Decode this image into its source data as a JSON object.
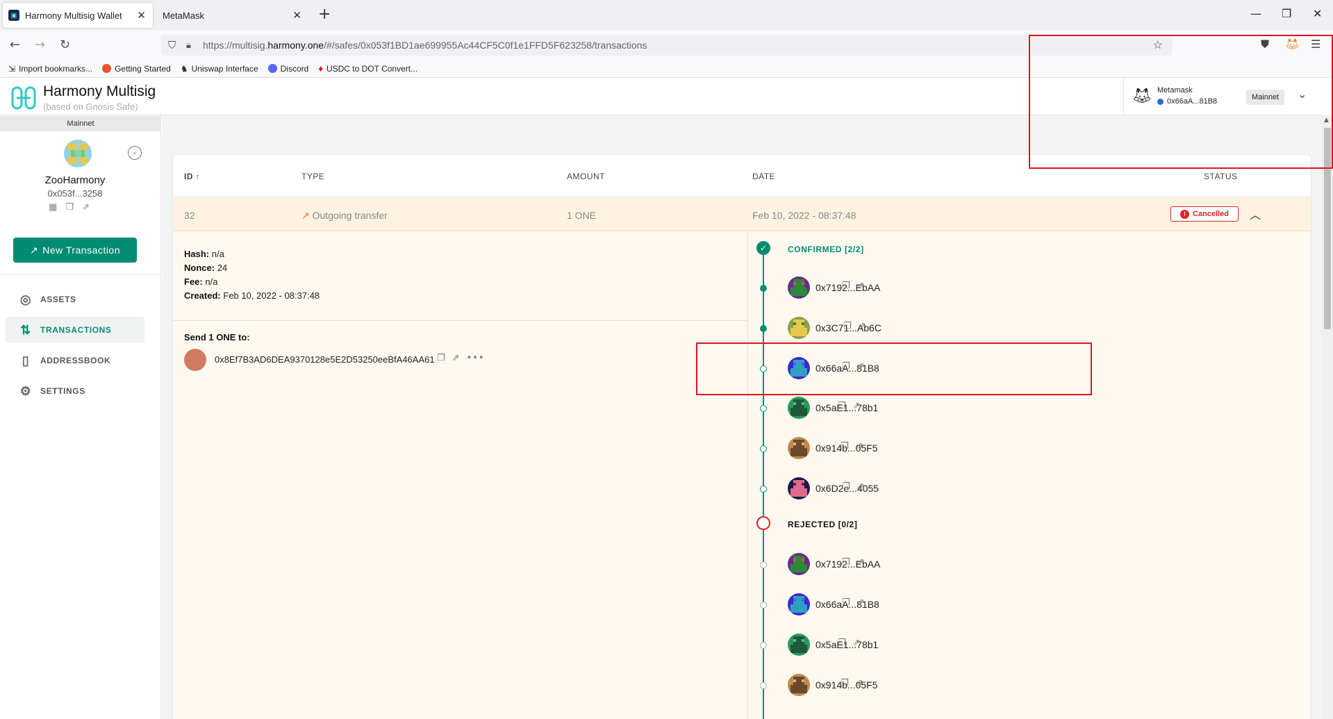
{
  "browser": {
    "tabs": [
      {
        "label": "Harmony Multisig Wallet",
        "active": true
      },
      {
        "label": "MetaMask",
        "active": false
      }
    ],
    "url_prefix": "https://multisig.",
    "url_host": "harmony.one",
    "url_path": "/#/safes/0x053f1BD1ae699955Ac44CF5C0f1e1FFD5F623258/transactions",
    "bookmarks": [
      {
        "label": "Import bookmarks...",
        "color": "#555555"
      },
      {
        "label": "Getting Started",
        "color": "#e8532a"
      },
      {
        "label": "Uniswap Interface",
        "color": "#ff007a"
      },
      {
        "label": "Discord",
        "color": "#5865f2"
      },
      {
        "label": "USDC to DOT Convert...",
        "color": "#e0141e"
      }
    ]
  },
  "header": {
    "title": "Harmony Multisig",
    "subtitle": "(based on Gnosis Safe)",
    "wallet": {
      "name": "Metamask",
      "address": "0x66aA...81B8",
      "network": "Mainnet"
    }
  },
  "sidebar": {
    "network": "Mainnet",
    "safe_name": "ZooHarmony",
    "safe_address": "0x053f...3258",
    "new_tx_label": "New Transaction",
    "menu": [
      {
        "label": "ASSETS",
        "icon": "assets-icon",
        "active": false
      },
      {
        "label": "TRANSACTIONS",
        "icon": "transactions-icon",
        "active": true
      },
      {
        "label": "ADDRESSBOOK",
        "icon": "addressbook-icon",
        "active": false
      },
      {
        "label": "SETTINGS",
        "icon": "settings-icon",
        "active": false
      }
    ]
  },
  "table": {
    "headers": {
      "id": "ID",
      "type": "TYPE",
      "amount": "AMOUNT",
      "date": "DATE",
      "status": "STATUS"
    },
    "row": {
      "id": "32",
      "type": "Outgoing transfer",
      "amount": "1 ONE",
      "date": "Feb 10, 2022 - 08:37:48",
      "status": "Cancelled"
    }
  },
  "details": {
    "hash_label": "Hash:",
    "hash": "n/a",
    "nonce_label": "Nonce:",
    "nonce": "24",
    "fee_label": "Fee:",
    "fee": "n/a",
    "created_label": "Created:",
    "created": "Feb 10, 2022 - 08:37:48",
    "send_label": "Send 1 ONE to:",
    "recipient": "0x8Ef7B3AD6DEA9370128e5E2D53250eeBfA46AA61"
  },
  "confirmations": {
    "confirmed_label": "CONFIRMED [2/2]",
    "confirmed": [
      "0x7192...EbAA",
      "0x3C71...Ab6C",
      "0x66aA...81B8",
      "0x5aE1...78b1",
      "0x914b...05F5",
      "0x6D2e...4055"
    ],
    "rejected_label": "REJECTED [0/2]",
    "rejected": [
      "0x7192...EbAA",
      "0x66aA...81B8",
      "0x5aE1...78b1",
      "0x914b...05F5"
    ]
  },
  "colors": {
    "accent": "#008c73",
    "cancelled": "#e02020",
    "annotation": "#e0141e"
  }
}
